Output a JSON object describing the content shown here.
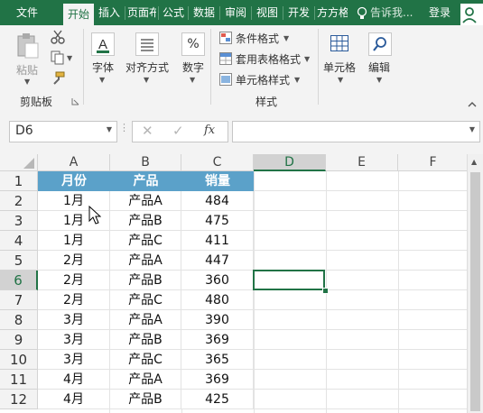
{
  "ribbon_tabs": [
    "文件",
    "开始",
    "插入",
    "页面布",
    "公式",
    "数据",
    "审阅",
    "视图",
    "开发",
    "方方格"
  ],
  "tell_me": "告诉我...",
  "login": "登录",
  "ribbon": {
    "paste": "粘贴",
    "clipboard_group": "剪贴板",
    "font": "字体",
    "alignment": "对齐方式",
    "number": "数字",
    "number_symbol": "%",
    "conditional_format": "条件格式",
    "table_format": "套用表格格式",
    "cell_style": "单元格样式",
    "styles_group": "样式",
    "cells": "单元格",
    "editing": "编辑"
  },
  "formula_bar": {
    "name_box": "D6",
    "fx": "fx",
    "value": ""
  },
  "columns": [
    "A",
    "B",
    "C",
    "D",
    "E",
    "F"
  ],
  "rows": [
    "1",
    "2",
    "3",
    "4",
    "5",
    "6",
    "7",
    "8",
    "9",
    "10",
    "11",
    "12"
  ],
  "table": {
    "headers": [
      "月份",
      "产品",
      "销量"
    ],
    "data": [
      [
        "1月",
        "产品A",
        "484"
      ],
      [
        "1月",
        "产品B",
        "475"
      ],
      [
        "1月",
        "产品C",
        "411"
      ],
      [
        "2月",
        "产品A",
        "447"
      ],
      [
        "2月",
        "产品B",
        "360"
      ],
      [
        "2月",
        "产品C",
        "480"
      ],
      [
        "3月",
        "产品A",
        "390"
      ],
      [
        "3月",
        "产品B",
        "369"
      ],
      [
        "3月",
        "产品C",
        "365"
      ],
      [
        "4月",
        "产品A",
        "369"
      ],
      [
        "4月",
        "产品B",
        "425"
      ]
    ]
  },
  "colors": {
    "accent": "#217346",
    "header_fill": "#5ba1c9"
  }
}
